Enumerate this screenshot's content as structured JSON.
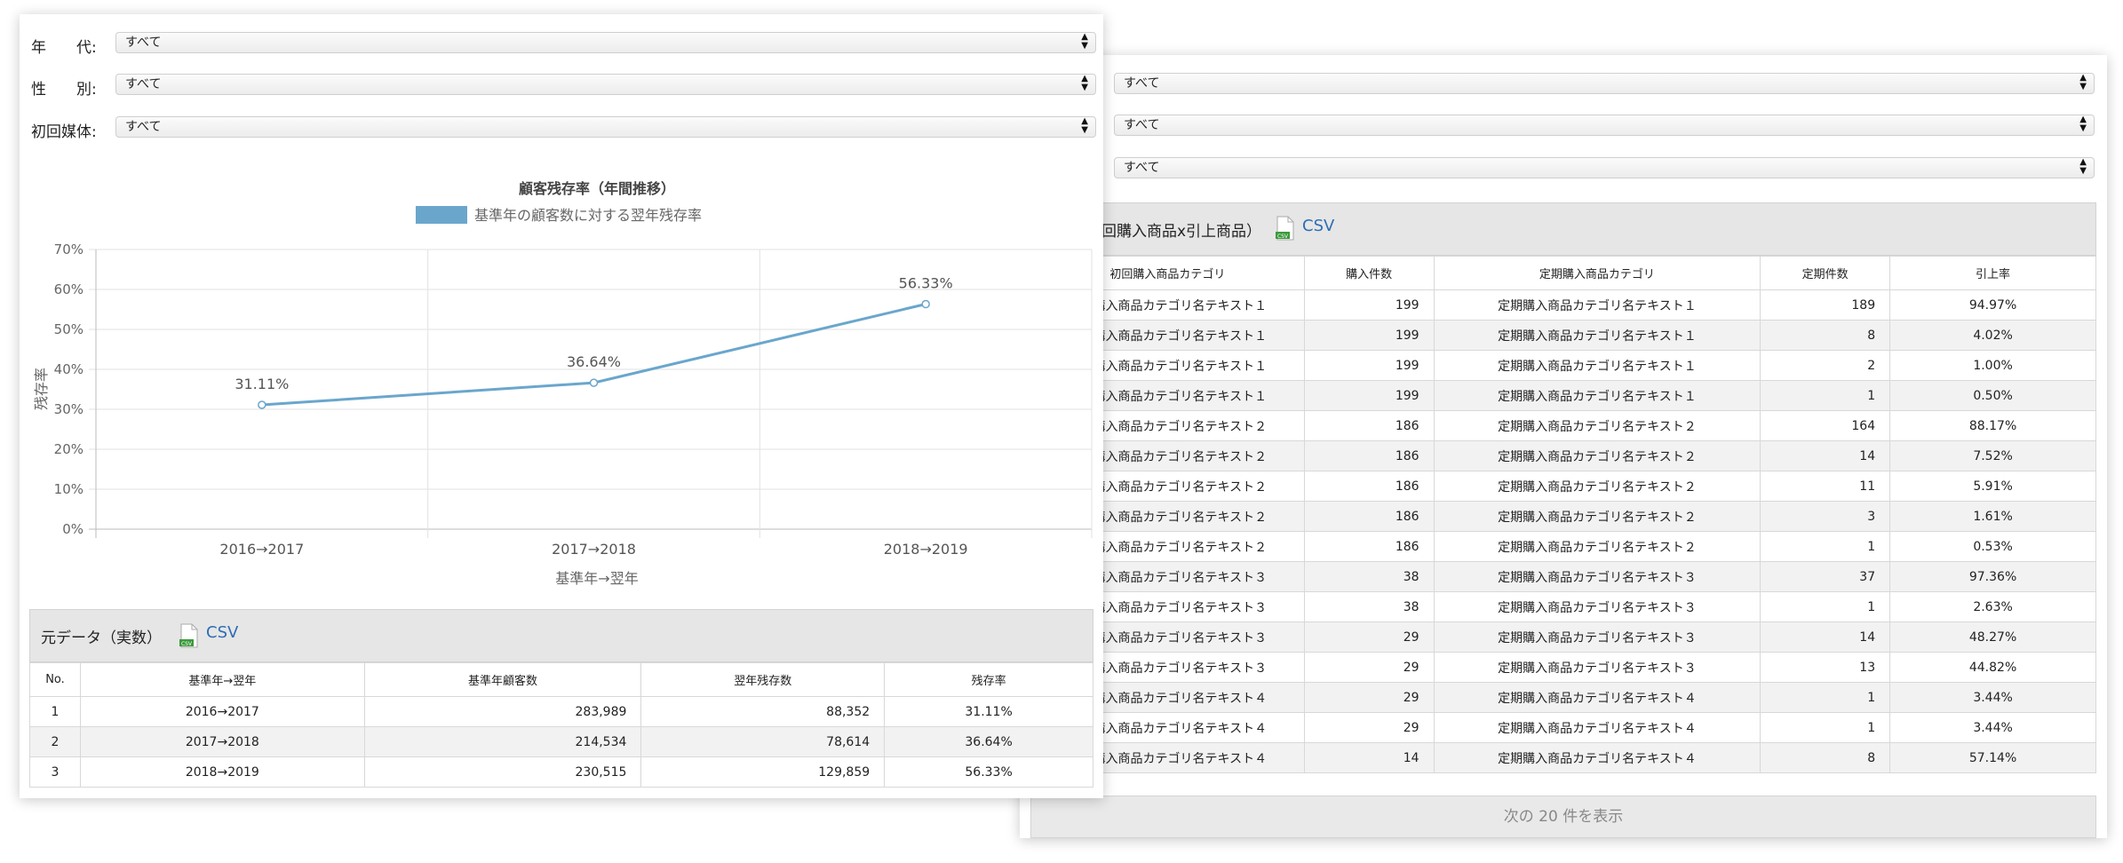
{
  "filters": {
    "age_label": "年　　代:",
    "gender_label": "性　　別:",
    "media_label": "初回媒体:",
    "age_value": "すべて",
    "gender_value": "すべて",
    "media_value": "すべて"
  },
  "right_filters": [
    "すべて",
    "すべて",
    "すべて"
  ],
  "chart_data": {
    "type": "line",
    "title": "顧客残存率（年間推移）",
    "xlabel": "基準年→翌年",
    "ylabel": "残存率",
    "categories": [
      "2016→2017",
      "2017→2018",
      "2018→2019"
    ],
    "series": [
      {
        "name": "基準年の顧客数に対する翌年残存率",
        "values": [
          31.11,
          36.64,
          56.33
        ],
        "labels": [
          "31.11%",
          "36.64%",
          "56.33%"
        ]
      }
    ],
    "ylim": [
      0,
      70
    ],
    "yticks": [
      "0%",
      "10%",
      "20%",
      "30%",
      "40%",
      "50%",
      "60%",
      "70%"
    ],
    "legend_position": "top",
    "grid": true,
    "color": "#6aa6cc"
  },
  "left_table": {
    "title": "元データ（実数）",
    "csv_label": "CSV",
    "headers": [
      "No.",
      "基準年→翌年",
      "基準年顧客数",
      "翌年残存数",
      "残存率"
    ],
    "rows": [
      [
        "1",
        "2016→2017",
        "283,989",
        "88,352",
        "31.11%"
      ],
      [
        "2",
        "2017→2018",
        "214,534",
        "78,614",
        "36.64%"
      ],
      [
        "3",
        "2018→2019",
        "230,515",
        "129,859",
        "56.33%"
      ]
    ]
  },
  "right_table": {
    "title": "回購入商品x引上商品）",
    "csv_label": "CSV",
    "headers": [
      "初回購入商品カテゴリ",
      "購入件数",
      "定期購入商品カテゴリ",
      "定期件数",
      "引上率"
    ],
    "rows": [
      [
        "初回購入商品カテゴリ名テキスト１",
        "199",
        "定期購入商品カテゴリ名テキスト１",
        "189",
        "94.97%"
      ],
      [
        "初回購入商品カテゴリ名テキスト１",
        "199",
        "定期購入商品カテゴリ名テキスト１",
        "8",
        "4.02%"
      ],
      [
        "初回購入商品カテゴリ名テキスト１",
        "199",
        "定期購入商品カテゴリ名テキスト１",
        "2",
        "1.00%"
      ],
      [
        "初回購入商品カテゴリ名テキスト１",
        "199",
        "定期購入商品カテゴリ名テキスト１",
        "1",
        "0.50%"
      ],
      [
        "初回購入商品カテゴリ名テキスト２",
        "186",
        "定期購入商品カテゴリ名テキスト２",
        "164",
        "88.17%"
      ],
      [
        "初回購入商品カテゴリ名テキスト２",
        "186",
        "定期購入商品カテゴリ名テキスト２",
        "14",
        "7.52%"
      ],
      [
        "初回購入商品カテゴリ名テキスト２",
        "186",
        "定期購入商品カテゴリ名テキスト２",
        "11",
        "5.91%"
      ],
      [
        "初回購入商品カテゴリ名テキスト２",
        "186",
        "定期購入商品カテゴリ名テキスト２",
        "3",
        "1.61%"
      ],
      [
        "初回購入商品カテゴリ名テキスト２",
        "186",
        "定期購入商品カテゴリ名テキスト２",
        "1",
        "0.53%"
      ],
      [
        "初回購入商品カテゴリ名テキスト３",
        "38",
        "定期購入商品カテゴリ名テキスト３",
        "37",
        "97.36%"
      ],
      [
        "初回購入商品カテゴリ名テキスト３",
        "38",
        "定期購入商品カテゴリ名テキスト３",
        "1",
        "2.63%"
      ],
      [
        "初回購入商品カテゴリ名テキスト３",
        "29",
        "定期購入商品カテゴリ名テキスト３",
        "14",
        "48.27%"
      ],
      [
        "初回購入商品カテゴリ名テキスト３",
        "29",
        "定期購入商品カテゴリ名テキスト３",
        "13",
        "44.82%"
      ],
      [
        "初回購入商品カテゴリ名テキスト４",
        "29",
        "定期購入商品カテゴリ名テキスト４",
        "1",
        "3.44%"
      ],
      [
        "初回購入商品カテゴリ名テキスト４",
        "29",
        "定期購入商品カテゴリ名テキスト４",
        "1",
        "3.44%"
      ],
      [
        "初回購入商品カテゴリ名テキスト４",
        "14",
        "定期購入商品カテゴリ名テキスト４",
        "8",
        "57.14%"
      ]
    ],
    "more_label": "次の 20 件を表示"
  }
}
